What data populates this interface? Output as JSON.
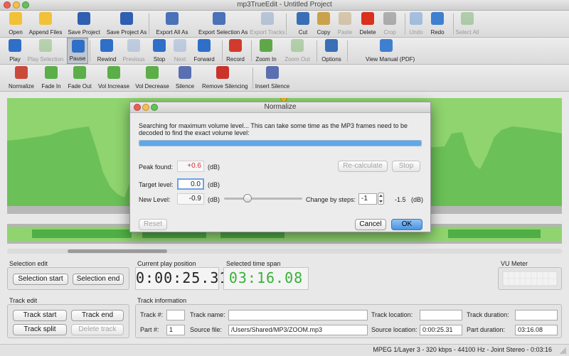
{
  "window": {
    "title": "mp3TrueEdit - Untitled Project"
  },
  "toolbar1": [
    {
      "label": "Open",
      "icon": "folder-open-icon",
      "color": "#f2c13a",
      "enabled": true
    },
    {
      "label": "Append Files",
      "icon": "folder-add-icon",
      "color": "#f2c13a",
      "enabled": true
    },
    {
      "label": "Save Project",
      "icon": "save-disk-icon",
      "color": "#2f5fb0",
      "enabled": true
    },
    {
      "label": "Save Project As",
      "icon": "save-as-icon",
      "color": "#2f5fb0",
      "enabled": true
    },
    {
      "label": "Export All As",
      "icon": "export-all-icon",
      "color": "#4a72b8",
      "enabled": true
    },
    {
      "label": "Export Selection As",
      "icon": "export-selection-icon",
      "color": "#4a72b8",
      "enabled": true
    },
    {
      "label": "Export Tracks",
      "icon": "export-tracks-icon",
      "color": "#6f8fbf",
      "enabled": false
    },
    {
      "label": "Cut",
      "icon": "scissors-icon",
      "color": "#3a6fb5",
      "enabled": true
    },
    {
      "label": "Copy",
      "icon": "copy-icon",
      "color": "#c9a24a",
      "enabled": true
    },
    {
      "label": "Paste",
      "icon": "paste-icon",
      "color": "#b99055",
      "enabled": false
    },
    {
      "label": "Delete",
      "icon": "delete-x-icon",
      "color": "#d93020",
      "enabled": true
    },
    {
      "label": "Crop",
      "icon": "crop-icon",
      "color": "#555555",
      "enabled": false
    },
    {
      "label": "Undo",
      "icon": "undo-arrow-icon",
      "color": "#3f7fd0",
      "enabled": false
    },
    {
      "label": "Redo",
      "icon": "redo-arrow-icon",
      "color": "#3f7fd0",
      "enabled": true
    },
    {
      "label": "Select All",
      "icon": "select-all-icon",
      "color": "#5aa04a",
      "enabled": false
    }
  ],
  "toolbar2": [
    {
      "label": "Play",
      "icon": "play-icon",
      "color": "#2f6fc8",
      "enabled": true
    },
    {
      "label": "Play Selection",
      "icon": "play-selection-icon",
      "color": "#6ab04f",
      "enabled": false
    },
    {
      "label": "Pause",
      "icon": "pause-icon",
      "color": "#2f6fc8",
      "enabled": true,
      "active": true
    },
    {
      "label": "Rewind",
      "icon": "rewind-icon",
      "color": "#2f6fc8",
      "enabled": true
    },
    {
      "label": "Previous",
      "icon": "previous-icon",
      "color": "#7f9fcf",
      "enabled": false
    },
    {
      "label": "Stop",
      "icon": "stop-icon",
      "color": "#2f6fc8",
      "enabled": true
    },
    {
      "label": "Next",
      "icon": "next-icon",
      "color": "#7f9fcf",
      "enabled": false
    },
    {
      "label": "Forward",
      "icon": "fast-forward-icon",
      "color": "#2f6fc8",
      "enabled": true
    },
    {
      "label": "Record",
      "icon": "record-icon",
      "color": "#d23a2e",
      "enabled": true
    },
    {
      "label": "Zoom In",
      "icon": "zoom-in-icon",
      "color": "#5fa84a",
      "enabled": true
    },
    {
      "label": "Zoom Out",
      "icon": "zoom-out-icon",
      "color": "#5fa84a",
      "enabled": false
    },
    {
      "label": "Options",
      "icon": "options-gear-icon",
      "color": "#3a6fb5",
      "enabled": true
    },
    {
      "label": "View Manual (PDF)",
      "icon": "manual-pdf-icon",
      "color": "#3f7fd0",
      "enabled": true
    }
  ],
  "toolbar3": [
    {
      "label": "Normalize",
      "icon": "normalize-icon",
      "color": "#c94a3a",
      "enabled": true
    },
    {
      "label": "Fade In",
      "icon": "fade-in-icon",
      "color": "#5cae49",
      "enabled": true
    },
    {
      "label": "Fade Out",
      "icon": "fade-out-icon",
      "color": "#5cae49",
      "enabled": true
    },
    {
      "label": "Vol Increase",
      "icon": "volume-increase-icon",
      "color": "#5cae49",
      "enabled": true
    },
    {
      "label": "Vol Decrease",
      "icon": "volume-decrease-icon",
      "color": "#5cae49",
      "enabled": true
    },
    {
      "label": "Silence",
      "icon": "silence-icon",
      "color": "#5a6fb0",
      "enabled": true
    },
    {
      "label": "Remove Silencing",
      "icon": "remove-silencing-icon",
      "color": "#c9332a",
      "enabled": true
    },
    {
      "label": "Insert Silence",
      "icon": "insert-silence-icon",
      "color": "#5a6fb0",
      "enabled": true
    }
  ],
  "waveform": {
    "color": "#8fd46e",
    "dark_color": "#3f9a3a"
  },
  "selection_edit": {
    "label": "Selection edit",
    "start_button": "Selection start",
    "end_button": "Selection end"
  },
  "play_position": {
    "label": "Current play position",
    "value": "0:00:25.31"
  },
  "time_span": {
    "label": "Selected time span",
    "value": "03:16.08",
    "color": "#35b335"
  },
  "vu_meter": {
    "label": "VU Meter"
  },
  "track_edit": {
    "label": "Track edit",
    "track_start": "Track start",
    "track_end": "Track end",
    "track_split": "Track split",
    "delete_track": "Delete track"
  },
  "track_info": {
    "label": "Track information",
    "track_no_label": "Track #:",
    "track_no_value": "",
    "track_name_label": "Track name:",
    "track_name_value": "",
    "track_location_label": "Track location:",
    "track_location_value": "",
    "track_duration_label": "Track duration:",
    "track_duration_value": "",
    "part_no_label": "Part #:",
    "part_no_value": "1",
    "source_file_label": "Source file:",
    "source_file_value": "/Users/Shared/MP3/ZOOM.mp3",
    "source_location_label": "Source location:",
    "source_location_value": "0:00:25.31",
    "part_duration_label": "Part duration:",
    "part_duration_value": "03:16.08"
  },
  "dialog": {
    "title": "Normalize",
    "message_line1": "Searching for maximum volume level... This can take some time as the MP3 frames need to be",
    "message_line2": "decoded to find the exact volume level:",
    "progress": 1.0,
    "progress_color": "#5ea8e8",
    "peak_label": "Peak found:",
    "peak_value": "+0.6",
    "peak_color": "#d43030",
    "db": "(dB)",
    "recalculate": "Re-calculate",
    "stop": "Stop",
    "target_label": "Target level:",
    "target_value": "0.0",
    "new_level_label": "New Level:",
    "new_level_value": "-0.9",
    "slider_value": 0.3,
    "steps_label": "Change by steps:",
    "steps_value": "-1",
    "steps_result": "-1.5",
    "reset": "Reset",
    "cancel": "Cancel",
    "ok": "OK"
  },
  "status": {
    "text": "MPEG 1/Layer 3 - 320 kbps - 44100 Hz - Joint Stereo - 0:03:16"
  }
}
